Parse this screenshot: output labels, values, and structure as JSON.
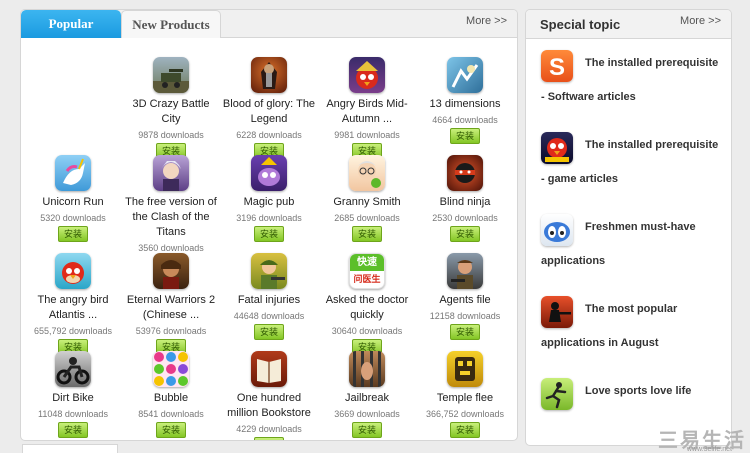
{
  "tabs": [
    {
      "label": "Popular",
      "active": true
    },
    {
      "label": "New Products",
      "active": false
    }
  ],
  "left_more": "More >>",
  "apps": [
    {
      "name": "3D Crazy Battle City",
      "downloads": "9878 downloads",
      "icon": "tank-game-icon",
      "install": "安装"
    },
    {
      "name": "Blood of glory: The Legend",
      "downloads": "6228 downloads",
      "icon": "warrior-game-icon",
      "install": "安装"
    },
    {
      "name": "Angry Birds Mid-Autumn ...",
      "downloads": "9981 downloads",
      "icon": "angry-bird-mid-autumn-icon",
      "install": "安装"
    },
    {
      "name": "13 dimensions",
      "downloads": "4664 downloads",
      "icon": "dimensions-game-icon",
      "install": "安装"
    },
    {
      "name": "Unicorn Run",
      "downloads": "5320 downloads",
      "icon": "unicorn-icon",
      "install": "安装"
    },
    {
      "name": "The free version of the Clash of the Titans",
      "downloads": "3560 downloads",
      "icon": "titan-anime-icon",
      "install": "安装"
    },
    {
      "name": "Magic pub",
      "downloads": "3196 downloads",
      "icon": "magic-pub-icon",
      "install": "安装"
    },
    {
      "name": "Granny Smith",
      "downloads": "2685 downloads",
      "icon": "granny-icon",
      "install": "安装"
    },
    {
      "name": "Blind ninja",
      "downloads": "2530 downloads",
      "icon": "ninja-icon",
      "install": "安装"
    },
    {
      "name": "The angry bird Atlantis ...",
      "downloads": "655,792 downloads",
      "icon": "angry-bird-icon",
      "install": "安装"
    },
    {
      "name": "Eternal Warriors 2 (Chinese ...",
      "downloads": "53976 downloads",
      "icon": "eternal-warrior-icon",
      "install": "安装"
    },
    {
      "name": "Fatal injuries",
      "downloads": "44648 downloads",
      "icon": "soldier-icon",
      "install": "安装"
    },
    {
      "name": "Asked the doctor quickly",
      "downloads": "30640 downloads",
      "icon": "doctor-app-icon",
      "install": "安装"
    },
    {
      "name": "Agents file",
      "downloads": "12158 downloads",
      "icon": "agent-icon",
      "install": "安装"
    },
    {
      "name": "Dirt Bike",
      "downloads": "11048 downloads",
      "icon": "dirt-bike-icon",
      "install": "安装"
    },
    {
      "name": "Bubble",
      "downloads": "8541 downloads",
      "icon": "bubble-icon",
      "install": "安装"
    },
    {
      "name": "One hundred million Bookstore",
      "downloads": "4229 downloads",
      "icon": "book-icon",
      "install": "安装"
    },
    {
      "name": "Jailbreak",
      "downloads": "3669 downloads",
      "icon": "jailbreak-icon",
      "install": "安装"
    },
    {
      "name": "Temple flee",
      "downloads": "366,752 downloads",
      "icon": "temple-run-icon",
      "install": "安装"
    }
  ],
  "doctor_icon_text": [
    "快速",
    "问医生"
  ],
  "special": {
    "title": "Special topic",
    "more": "More >>",
    "items": [
      {
        "title": "The installed prerequisite",
        "subtitle": "- Software articles",
        "icon": "sogou-s-icon"
      },
      {
        "title": "The installed prerequisite",
        "subtitle": "- game articles",
        "icon": "angry-birds-space-icon"
      },
      {
        "title": "Freshmen must-have",
        "subtitle": "applications",
        "icon": "robot-face-icon"
      },
      {
        "title": "The most popular",
        "subtitle": "applications in August",
        "icon": "silhouette-soldier-icon"
      },
      {
        "title": "Love sports love life",
        "subtitle": "",
        "icon": "parkour-icon"
      }
    ]
  },
  "watermark": {
    "text": "三易生活",
    "url": "www.3elife.net"
  },
  "colors": {
    "tab_active": "#1a9ae0",
    "install_button": "#84c625",
    "panel_border": "#d6d6d6"
  }
}
